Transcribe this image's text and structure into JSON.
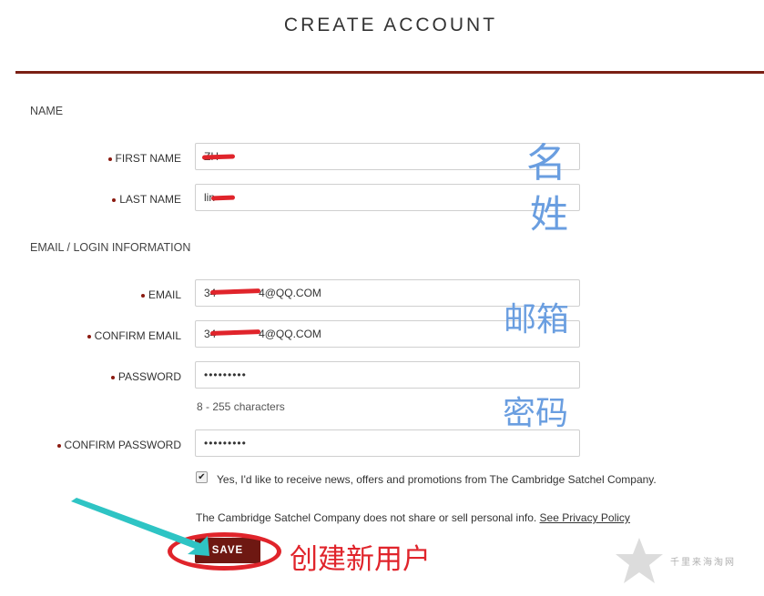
{
  "page": {
    "title": "CREATE ACCOUNT"
  },
  "sections": {
    "name": "NAME",
    "email_login": "EMAIL / LOGIN INFORMATION"
  },
  "fields": {
    "first_name": {
      "label": "FIRST NAME",
      "value": "ZH"
    },
    "last_name": {
      "label": "LAST NAME",
      "value": "lin"
    },
    "email": {
      "label": "EMAIL",
      "value": "34       4@QQ.COM"
    },
    "confirm_email": {
      "label": "CONFIRM EMAIL",
      "value": "34       4@QQ.COM"
    },
    "password": {
      "label": "PASSWORD",
      "value": "•••••••••",
      "helper": "8 - 255 characters"
    },
    "confirm_password": {
      "label": "CONFIRM PASSWORD",
      "value": "•••••••••"
    }
  },
  "newsletter": {
    "checked": true,
    "label": "Yes, I'd like to receive news, offers and promotions from The Cambridge Satchel Company."
  },
  "privacy": {
    "text": "The Cambridge Satchel Company does not share or sell personal info.",
    "link_label": "See Privacy Policy"
  },
  "save_label": "SAVE",
  "annotations": {
    "first_name": "名",
    "last_name": "姓",
    "email": "邮箱",
    "password": "密码",
    "create_user": "创建新用户",
    "watermark": "千里来海淘网"
  },
  "colors": {
    "accent": "#7a1f14",
    "button": "#6e1812",
    "annotation_blue": "#6a9ee0",
    "annotation_red": "#e0242b",
    "arrow": "#2ec4c4"
  },
  "icons": [
    "checkbox-check-icon",
    "arrow-annotation",
    "star-watermark-icon"
  ]
}
